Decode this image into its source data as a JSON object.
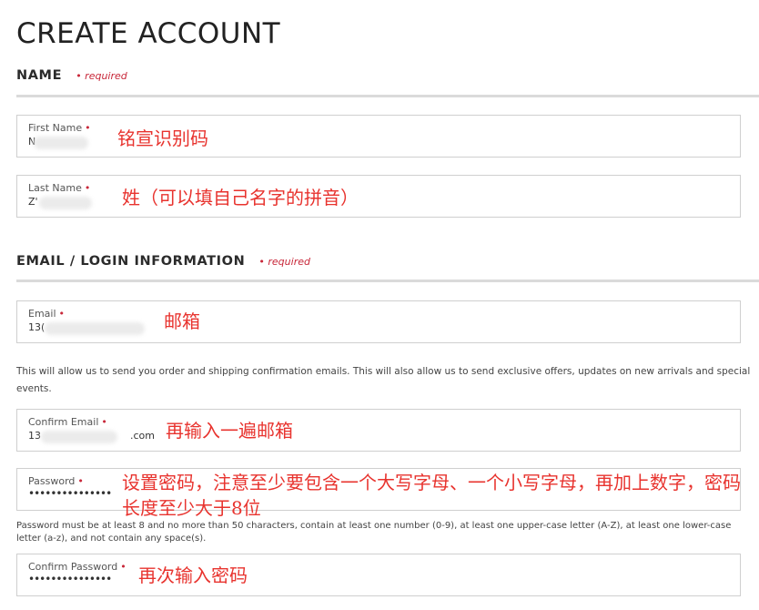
{
  "page": {
    "title": "CREATE ACCOUNT"
  },
  "sections": {
    "name": {
      "title": "NAME",
      "required": "• required"
    },
    "email": {
      "title": "EMAIL / LOGIN INFORMATION",
      "required": "• required"
    }
  },
  "fields": {
    "first_name": {
      "label": "First Name",
      "dot": "•",
      "value": "N",
      "annotation": "铭宣识别码"
    },
    "last_name": {
      "label": "Last Name",
      "dot": "•",
      "value": "Z'",
      "annotation": "姓（可以填自己名字的拼音）"
    },
    "email": {
      "label": "Email",
      "dot": "•",
      "value": "13(",
      "annotation": "邮箱"
    },
    "confirm_email": {
      "label": "Confirm Email",
      "dot": "•",
      "value_prefix": "13",
      "value_suffix": ".com",
      "annotation": "再输入一遍邮箱"
    },
    "password": {
      "label": "Password",
      "dot": "•",
      "value": "•••••••••••••••",
      "annotation": "设置密码，注意至少要包含一个大写字母、一个小写字母，再加上数字，密码长度至少大于8位"
    },
    "confirm_password": {
      "label": "Confirm Password",
      "dot": "•",
      "value": "•••••••••••••••",
      "annotation": "再次输入密码"
    }
  },
  "notes": {
    "email_info": "This will allow us to send you order and shipping confirmation emails.   This will also allow us to send exclusive offers, updates on new arrivals and special events.",
    "password_rules": "Password must be at least 8 and no more than 50 characters, contain at least one number (0-9), at least one upper-case letter (A-Z), at least one lower-case letter (a-z), and not contain any space(s)."
  }
}
